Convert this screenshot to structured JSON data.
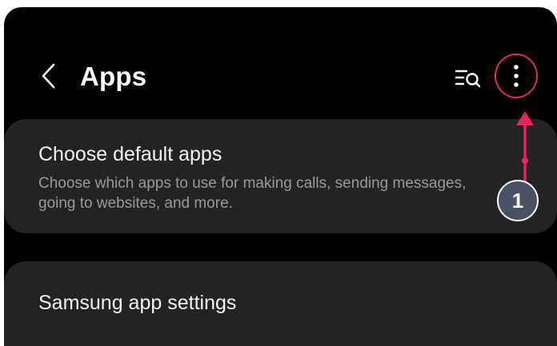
{
  "header": {
    "title": "Apps",
    "back_icon": "chevron-left-icon",
    "search_icon": "filter-search-icon",
    "more_icon": "more-vertical-icon"
  },
  "cards": {
    "default_apps": {
      "title": "Choose default apps",
      "description": "Choose which apps to use for making calls, sending messages, going to websites, and more."
    },
    "samsung_settings": {
      "title": "Samsung app settings"
    }
  },
  "annotation": {
    "step_number": "1",
    "accent_color": "#e8245a",
    "badge_color": "#4a5068"
  },
  "colors": {
    "background": "#000000",
    "card": "#232323",
    "text_primary": "#f2f2f2",
    "text_secondary": "#9a9a9a"
  }
}
